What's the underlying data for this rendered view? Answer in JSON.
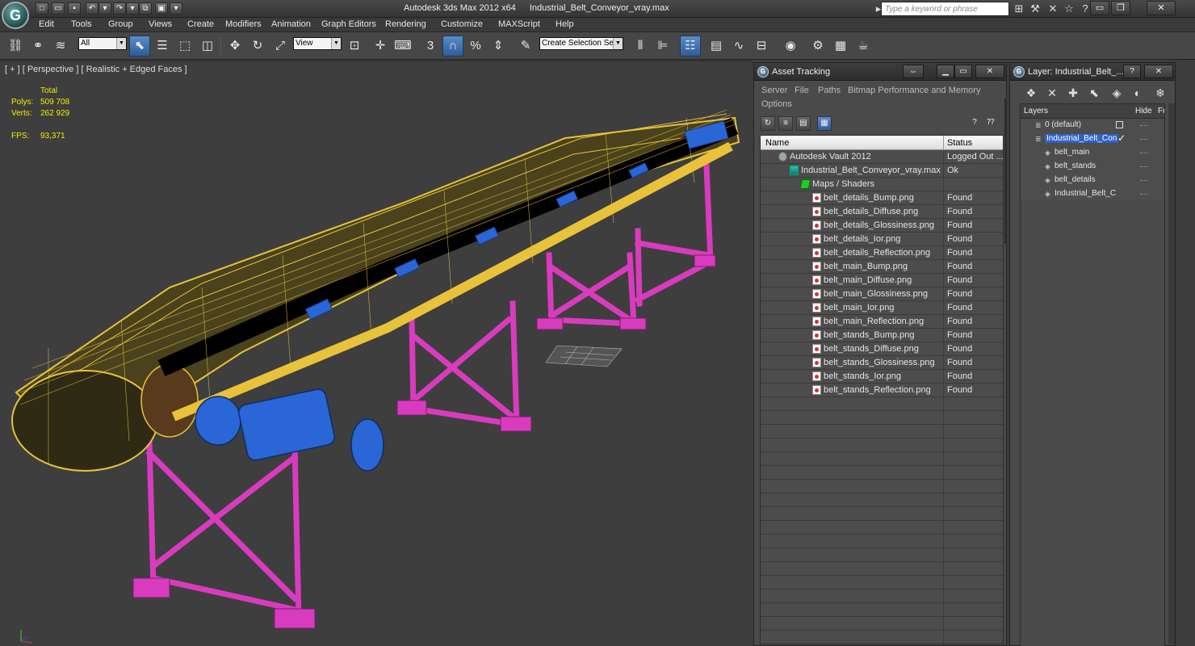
{
  "title_bar": {
    "app_name": "Autodesk 3ds Max  2012 x64",
    "file_name": "Industrial_Belt_Conveyor_vray.max",
    "search_placeholder": "Type a keyword or phrase",
    "logo_glyph": "G"
  },
  "menu": {
    "items": [
      "Edit",
      "Tools",
      "Group",
      "Views",
      "Create",
      "Modifiers",
      "Animation",
      "Graph Editors",
      "Rendering",
      "Customize",
      "MAXScript",
      "Help"
    ]
  },
  "toolbar": {
    "selection_filter": "All",
    "reference_coord": "View",
    "named_selection_placeholder": "Create Selection Se"
  },
  "viewport": {
    "label": "[ + ] [ Perspective ] [ Realistic + Edged Faces ]",
    "stats": {
      "total_label": "Total",
      "polys_label": "Polys:",
      "polys_value": "509 708",
      "verts_label": "Verts:",
      "verts_value": "262 929",
      "fps_label": "FPS:",
      "fps_value": "93,371"
    },
    "colors": {
      "belt": "#e8c23a",
      "stands": "#d93bbf",
      "motor": "#2a66d6"
    }
  },
  "asset_tracking": {
    "title": "Asset Tracking",
    "menu": [
      "Server",
      "File",
      "Paths",
      "Bitmap Performance and Memory",
      "Options"
    ],
    "columns": {
      "name": "Name",
      "status": "Status"
    },
    "rows": [
      {
        "name": "Autodesk Vault 2012",
        "status": "Logged Out ...",
        "indent": 0,
        "icon": "vault"
      },
      {
        "name": "Industrial_Belt_Conveyor_vray.max",
        "status": "Ok",
        "indent": 1,
        "icon": "max"
      },
      {
        "name": "Maps / Shaders",
        "status": "",
        "indent": 2,
        "icon": "maps"
      },
      {
        "name": "belt_details_Bump.png",
        "status": "Found",
        "indent": 3,
        "icon": "file"
      },
      {
        "name": "belt_details_Diffuse.png",
        "status": "Found",
        "indent": 3,
        "icon": "file"
      },
      {
        "name": "belt_details_Glossiness.png",
        "status": "Found",
        "indent": 3,
        "icon": "file"
      },
      {
        "name": "belt_details_Ior.png",
        "status": "Found",
        "indent": 3,
        "icon": "file"
      },
      {
        "name": "belt_details_Reflection.png",
        "status": "Found",
        "indent": 3,
        "icon": "file"
      },
      {
        "name": "belt_main_Bump.png",
        "status": "Found",
        "indent": 3,
        "icon": "file"
      },
      {
        "name": "belt_main_Diffuse.png",
        "status": "Found",
        "indent": 3,
        "icon": "file"
      },
      {
        "name": "belt_main_Glossiness.png",
        "status": "Found",
        "indent": 3,
        "icon": "file"
      },
      {
        "name": "belt_main_Ior.png",
        "status": "Found",
        "indent": 3,
        "icon": "file"
      },
      {
        "name": "belt_main_Reflection.png",
        "status": "Found",
        "indent": 3,
        "icon": "file"
      },
      {
        "name": "belt_stands_Bump.png",
        "status": "Found",
        "indent": 3,
        "icon": "file"
      },
      {
        "name": "belt_stands_Diffuse.png",
        "status": "Found",
        "indent": 3,
        "icon": "file"
      },
      {
        "name": "belt_stands_Glossiness.png",
        "status": "Found",
        "indent": 3,
        "icon": "file"
      },
      {
        "name": "belt_stands_Ior.png",
        "status": "Found",
        "indent": 3,
        "icon": "file"
      },
      {
        "name": "belt_stands_Reflection.png",
        "status": "Found",
        "indent": 3,
        "icon": "file"
      }
    ]
  },
  "layer_panel": {
    "title": "Layer: Industrial_Belt_...",
    "columns": {
      "layers": "Layers",
      "hide": "Hide",
      "freeze": "Fr"
    },
    "rows": [
      {
        "name": "0 (default)",
        "indent": 0,
        "selected": false,
        "checkbox": true
      },
      {
        "name": "Industrial_Belt_Con",
        "indent": 0,
        "selected": true,
        "current": true
      },
      {
        "name": "belt_main",
        "indent": 1,
        "selected": false
      },
      {
        "name": "belt_stands",
        "indent": 1,
        "selected": false
      },
      {
        "name": "belt_details",
        "indent": 1,
        "selected": false
      },
      {
        "name": "Industrial_Belt_C",
        "indent": 1,
        "selected": false
      }
    ]
  }
}
